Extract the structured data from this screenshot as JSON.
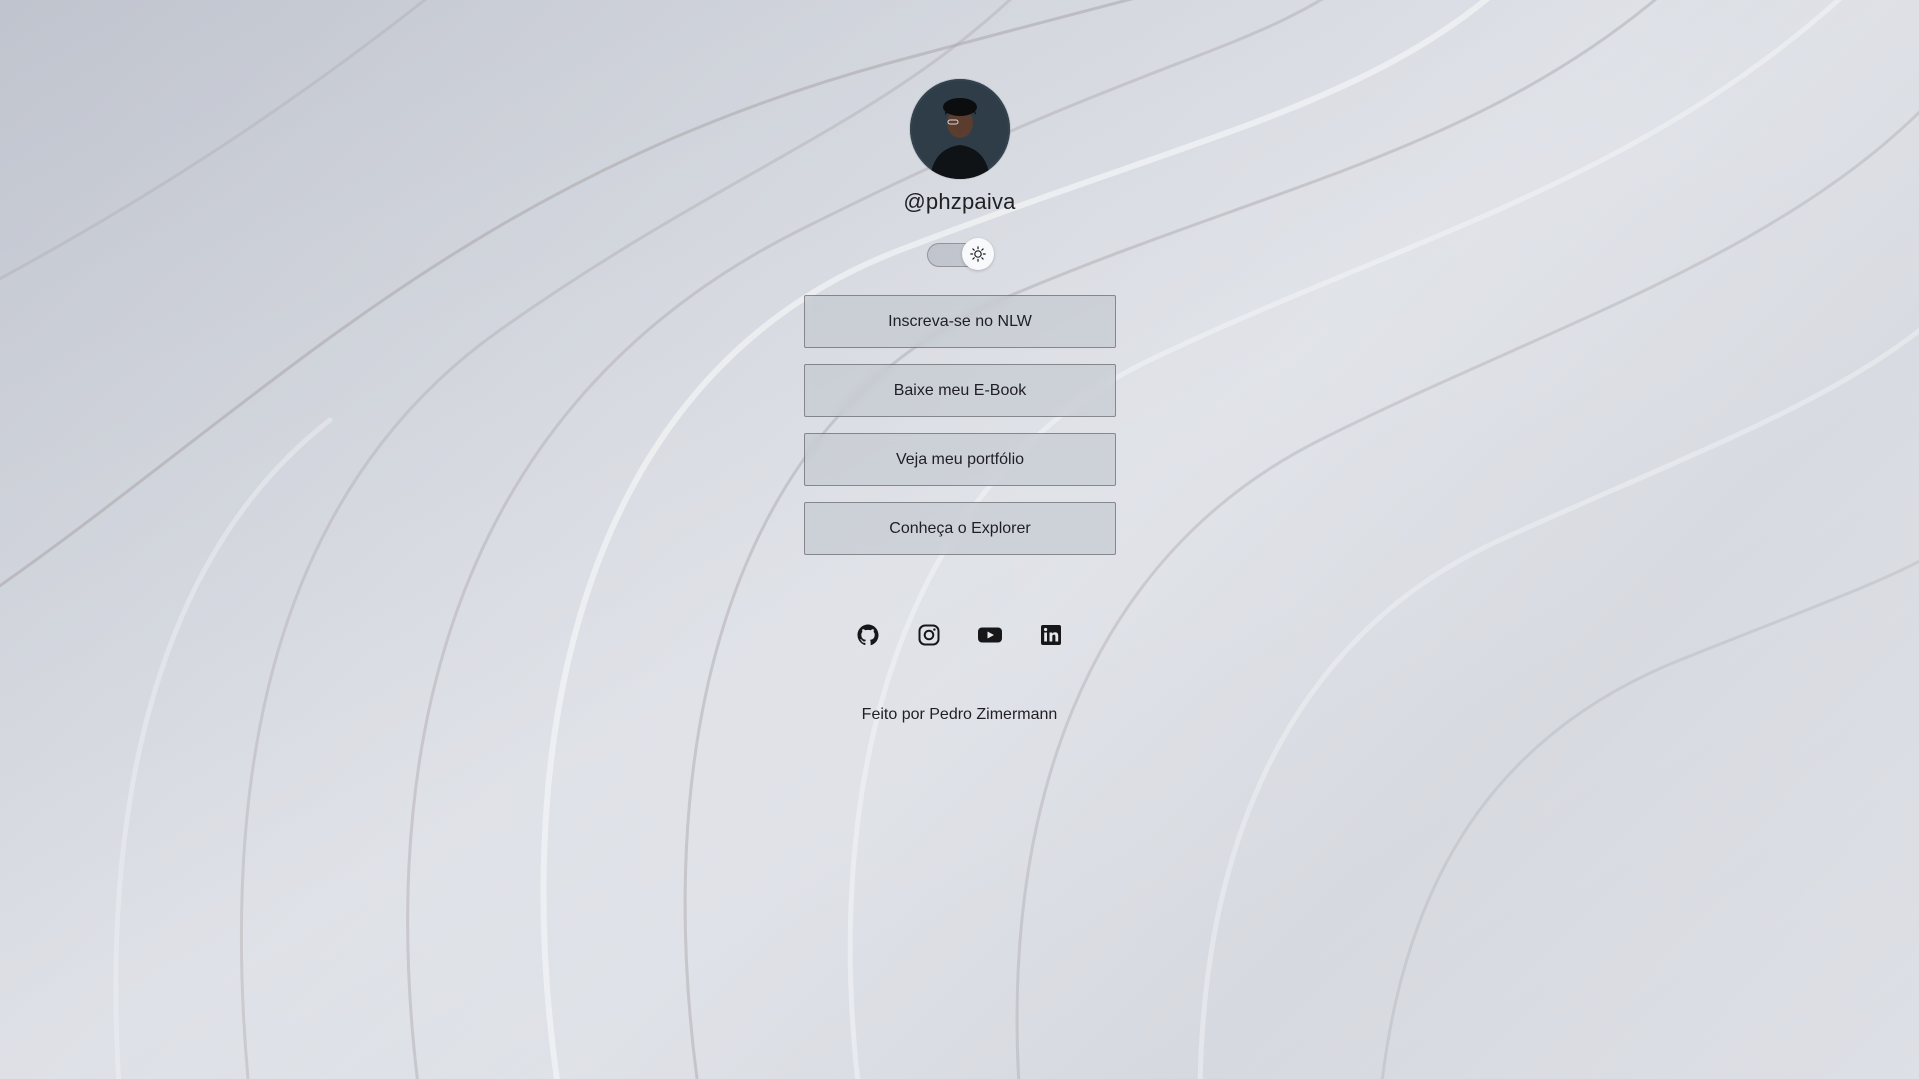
{
  "profile": {
    "handle": "@phzpaiva",
    "avatar_alt": "Pedro Zimermann"
  },
  "theme_switch": {
    "icon": "sun-icon",
    "mode": "light"
  },
  "links": [
    {
      "label": "Inscreva-se no NLW"
    },
    {
      "label": "Baixe meu E-Book"
    },
    {
      "label": "Veja meu portfólio"
    },
    {
      "label": "Conheça o Explorer"
    }
  ],
  "social": [
    {
      "name": "github-icon"
    },
    {
      "name": "instagram-icon"
    },
    {
      "name": "youtube-icon"
    },
    {
      "name": "linkedin-icon"
    }
  ],
  "footer": {
    "text": "Feito por Pedro Zimermann"
  },
  "colors": {
    "background": "#d9dce3",
    "button_bg": "#c4c8cf",
    "text": "#1f1f24"
  }
}
